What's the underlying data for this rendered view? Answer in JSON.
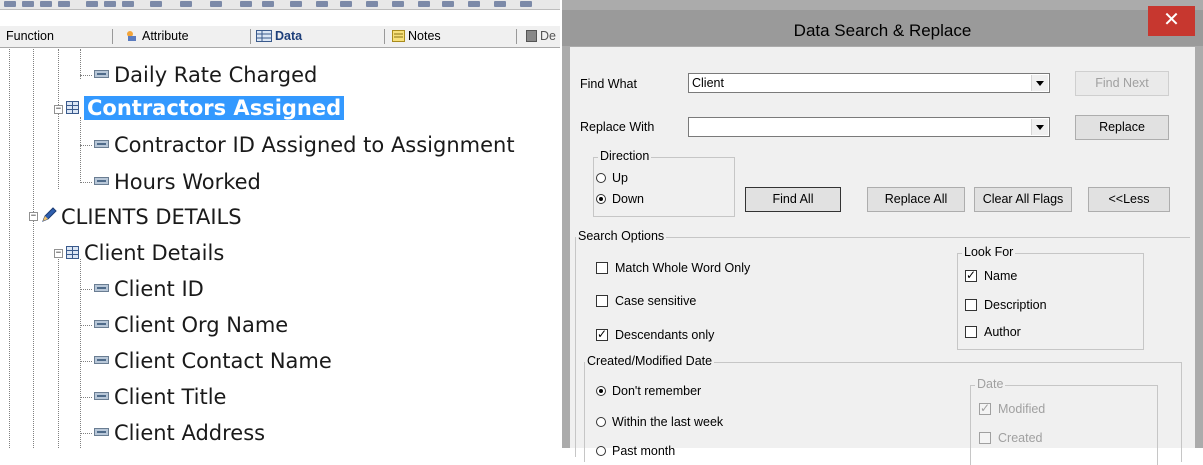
{
  "tabs": [
    {
      "label": "Function",
      "icon": "none"
    },
    {
      "label": "Attribute",
      "icon": "attribute-icon"
    },
    {
      "label": "Data",
      "icon": "data-table-icon"
    },
    {
      "label": "Notes",
      "icon": "notes-icon"
    },
    {
      "label": "De",
      "icon": "document-icon"
    }
  ],
  "tree": [
    {
      "label": "Daily Rate Charged",
      "type": "attribute"
    },
    {
      "label": "Contractors Assigned",
      "type": "entity",
      "selected": true
    },
    {
      "label": "Contractor ID Assigned to Assignment",
      "type": "attribute"
    },
    {
      "label": "Hours Worked",
      "type": "attribute"
    },
    {
      "label": "CLIENTS  DETAILS",
      "type": "subject-area"
    },
    {
      "label": "Client Details",
      "type": "entity"
    },
    {
      "label": "Client ID",
      "type": "attribute"
    },
    {
      "label": "Client Org Name",
      "type": "attribute"
    },
    {
      "label": "Client Contact Name",
      "type": "attribute"
    },
    {
      "label": "Client Title",
      "type": "attribute"
    },
    {
      "label": "Client Address",
      "type": "attribute"
    }
  ],
  "dialog": {
    "title": "Data Search & Replace",
    "close": "✕",
    "find_label": "Find What",
    "find_value": "Client",
    "replace_label": "Replace With",
    "replace_value": "",
    "find_next": "Find Next",
    "replace": "Replace",
    "direction": {
      "caption": "Direction",
      "up": "Up",
      "down": "Down",
      "selected": "Down"
    },
    "find_all": "Find All",
    "replace_all": "Replace All",
    "clear_flags": "Clear All Flags",
    "less": "<<Less",
    "search_options": {
      "caption": "Search Options",
      "match_whole": {
        "label": "Match Whole Word Only",
        "checked": false
      },
      "case_sensitive": {
        "label": "Case sensitive",
        "checked": false
      },
      "descendants": {
        "label": "Descendants only",
        "checked": true
      }
    },
    "look_for": {
      "caption": "Look For",
      "name": {
        "label": "Name",
        "checked": true
      },
      "description": {
        "label": "Description",
        "checked": false
      },
      "author": {
        "label": "Author",
        "checked": false
      }
    },
    "date": {
      "caption": "Created/Modified Date",
      "dont_remember": "Don't remember",
      "last_week": "Within the last week",
      "past_month": "Past month",
      "selected": "Don't remember",
      "sub_caption": "Date",
      "modified": {
        "label": "Modified",
        "checked": true
      },
      "created": {
        "label": "Created",
        "checked": false
      }
    }
  }
}
